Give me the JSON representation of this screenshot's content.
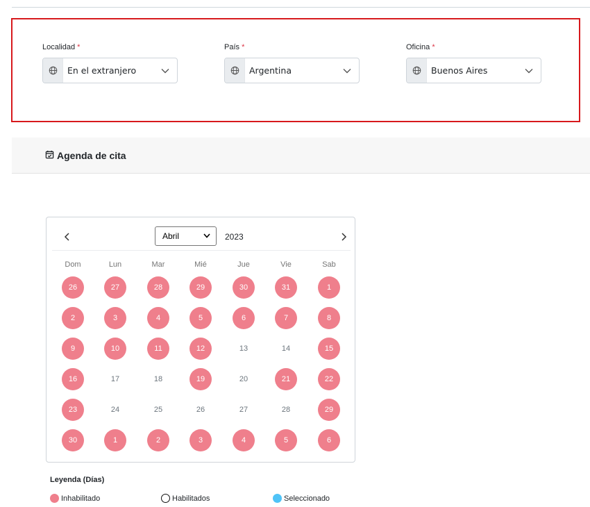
{
  "filters": {
    "locality": {
      "label": "Localidad",
      "required_mark": "*",
      "value": "En el extranjero",
      "icon": "globe-icon"
    },
    "country": {
      "label": "País",
      "required_mark": "*",
      "value": "Argentina",
      "icon": "globe-icon"
    },
    "office": {
      "label": "Oficina",
      "required_mark": "*",
      "value": "Buenos Aires",
      "icon": "globe-icon"
    }
  },
  "agenda": {
    "title": "Agenda de cita",
    "icon": "calendar-check-icon"
  },
  "calendar": {
    "month": "Abril",
    "year": "2023",
    "weekdays": [
      "Dom",
      "Lun",
      "Mar",
      "Mié",
      "Jue",
      "Vie",
      "Sab"
    ],
    "weeks": [
      [
        {
          "d": "26",
          "off": true
        },
        {
          "d": "27",
          "off": true
        },
        {
          "d": "28",
          "off": true
        },
        {
          "d": "29",
          "off": true
        },
        {
          "d": "30",
          "off": true
        },
        {
          "d": "31",
          "off": true
        },
        {
          "d": "1",
          "off": true
        }
      ],
      [
        {
          "d": "2",
          "off": true
        },
        {
          "d": "3",
          "off": true
        },
        {
          "d": "4",
          "off": true
        },
        {
          "d": "5",
          "off": true
        },
        {
          "d": "6",
          "off": true
        },
        {
          "d": "7",
          "off": true
        },
        {
          "d": "8",
          "off": true
        }
      ],
      [
        {
          "d": "9",
          "off": true
        },
        {
          "d": "10",
          "off": true
        },
        {
          "d": "11",
          "off": true
        },
        {
          "d": "12",
          "off": true
        },
        {
          "d": "13",
          "off": false
        },
        {
          "d": "14",
          "off": false
        },
        {
          "d": "15",
          "off": true
        }
      ],
      [
        {
          "d": "16",
          "off": true
        },
        {
          "d": "17",
          "off": false
        },
        {
          "d": "18",
          "off": false
        },
        {
          "d": "19",
          "off": true
        },
        {
          "d": "20",
          "off": false
        },
        {
          "d": "21",
          "off": true
        },
        {
          "d": "22",
          "off": true
        }
      ],
      [
        {
          "d": "23",
          "off": true
        },
        {
          "d": "24",
          "off": false
        },
        {
          "d": "25",
          "off": false
        },
        {
          "d": "26",
          "off": false
        },
        {
          "d": "27",
          "off": false
        },
        {
          "d": "28",
          "off": false
        },
        {
          "d": "29",
          "off": true
        }
      ],
      [
        {
          "d": "30",
          "off": true
        },
        {
          "d": "1",
          "off": true
        },
        {
          "d": "2",
          "off": true
        },
        {
          "d": "3",
          "off": true
        },
        {
          "d": "4",
          "off": true
        },
        {
          "d": "5",
          "off": true
        },
        {
          "d": "6",
          "off": true
        }
      ]
    ]
  },
  "legend": {
    "title": "Leyenda (Días)",
    "items": [
      {
        "label": "Inhabilitado",
        "color": "#ef7f8c"
      },
      {
        "label": "Habilitados",
        "color": "#ffffff"
      },
      {
        "label": "Seleccionado",
        "color": "#4fc3f7"
      }
    ]
  },
  "colors": {
    "panel_border": "#d7191c",
    "disabled_day": "#ef7f8c",
    "selected_day": "#4fc3f7"
  }
}
